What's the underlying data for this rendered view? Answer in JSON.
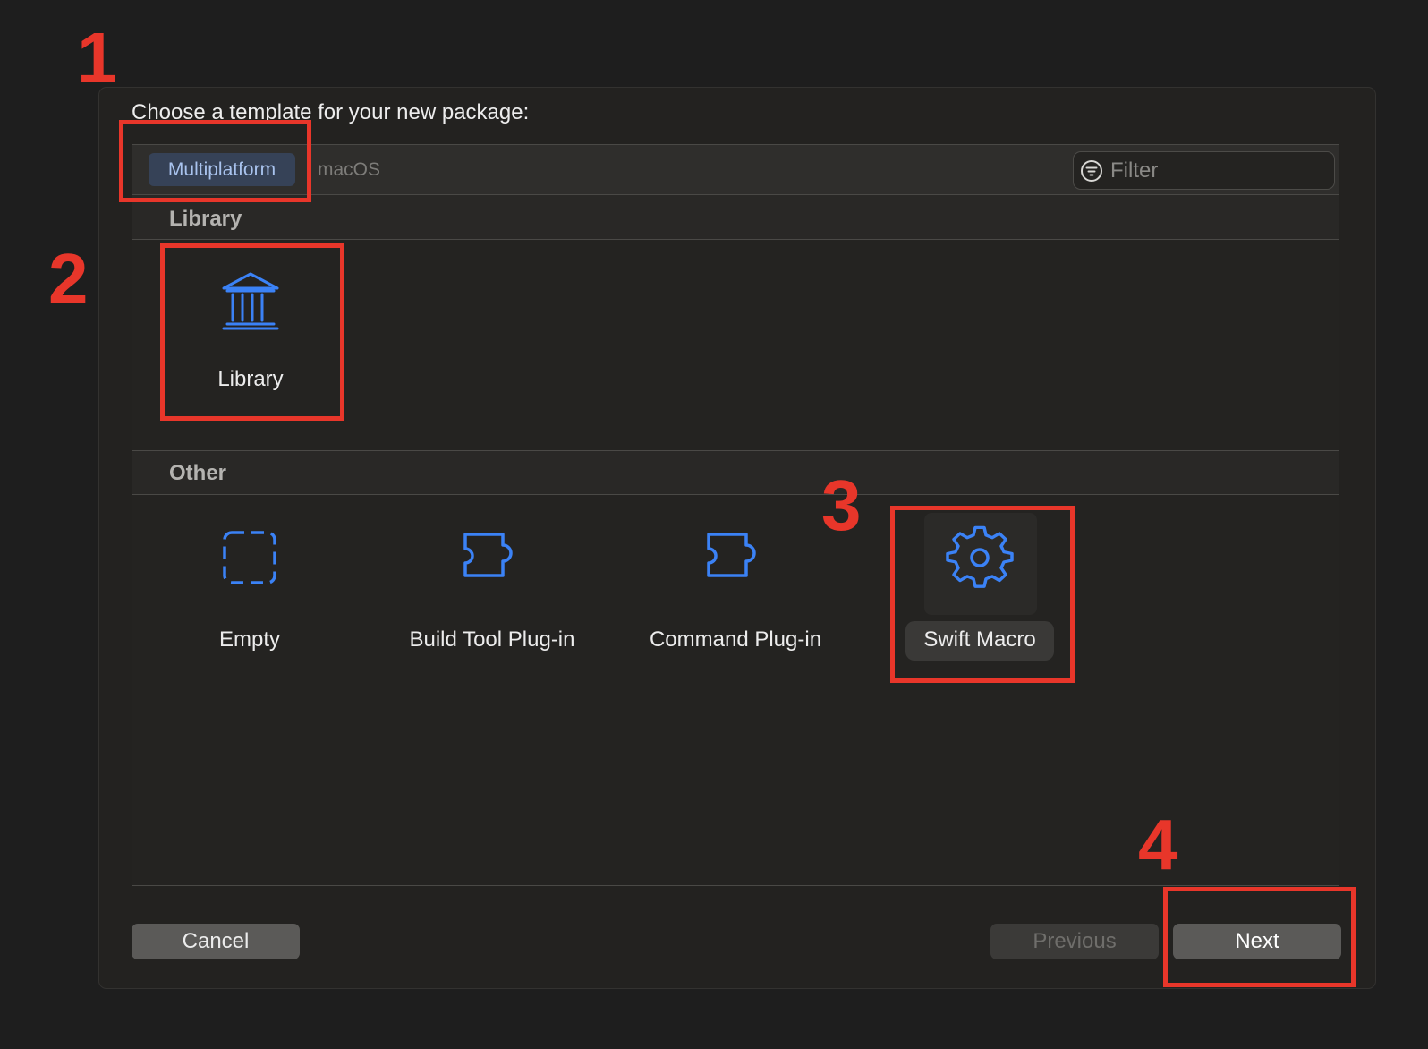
{
  "dialog": {
    "prompt": "Choose a template for your new package:"
  },
  "platform_tabs": [
    {
      "label": "Multiplatform",
      "selected": true
    },
    {
      "label": "macOS",
      "selected": false
    }
  ],
  "filter": {
    "placeholder": "Filter",
    "icon": "filter-circle-icon"
  },
  "sections": [
    {
      "title": "Library",
      "templates": [
        {
          "label": "Library",
          "icon": "building-columns-icon"
        }
      ]
    },
    {
      "title": "Other",
      "templates": [
        {
          "label": "Empty",
          "icon": "dashed-square-icon"
        },
        {
          "label": "Build Tool Plug-in",
          "icon": "puzzle-piece-icon"
        },
        {
          "label": "Command Plug-in",
          "icon": "puzzle-piece-icon"
        },
        {
          "label": "Swift Macro",
          "icon": "gear-icon",
          "selected": true
        }
      ]
    }
  ],
  "buttons": {
    "cancel": "Cancel",
    "previous": "Previous",
    "next": "Next"
  },
  "annotations": {
    "numbers": [
      "1",
      "2",
      "3",
      "4"
    ],
    "color": "#e8362a"
  },
  "colors": {
    "accent": "#3b82f6",
    "selected_tab_bg": "#364257",
    "selected_tab_text": "#a9c3ee"
  }
}
